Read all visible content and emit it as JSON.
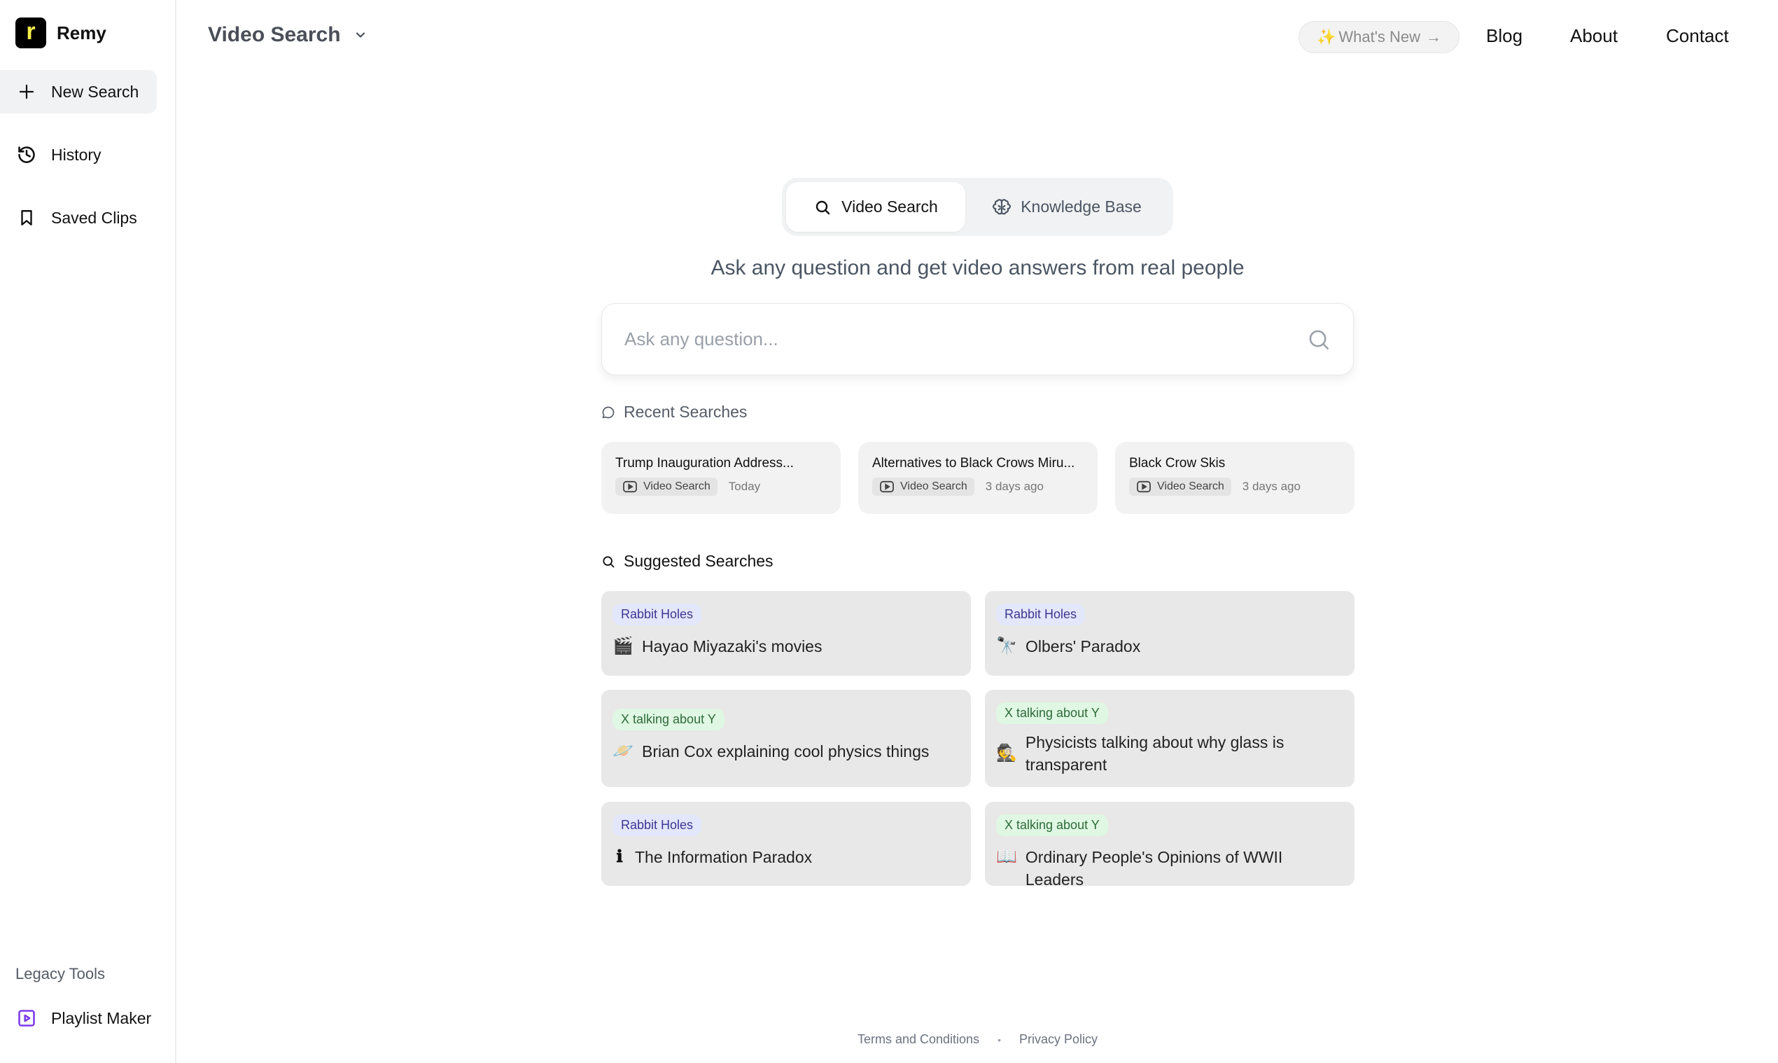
{
  "sidebar": {
    "brand": {
      "logo_letter": "r",
      "name": "Remy"
    },
    "items": [
      {
        "label": "New Search",
        "icon": "plus-icon",
        "active": true
      },
      {
        "label": "History",
        "icon": "history-icon",
        "active": false
      },
      {
        "label": "Saved Clips",
        "icon": "bookmark-icon",
        "active": false
      }
    ],
    "legacy": {
      "label": "Legacy Tools",
      "items": [
        {
          "label": "Playlist Maker",
          "icon": "play-square-icon",
          "icon_color": "#7c3aed"
        }
      ]
    }
  },
  "header": {
    "title": "Video Search",
    "whats_new": {
      "sparkle": "✨",
      "label": "What's New",
      "arrow": "→"
    },
    "links": [
      "Blog",
      "About",
      "Contact"
    ]
  },
  "mode_tabs": [
    {
      "label": "Video Search",
      "icon": "search-icon",
      "active": true
    },
    {
      "label": "Knowledge Base",
      "icon": "brain-icon",
      "active": false
    }
  ],
  "subtitle": "Ask any question and get video answers from real people",
  "search": {
    "placeholder": "Ask any question...",
    "value": ""
  },
  "recent": {
    "label": "Recent Searches",
    "items": [
      {
        "title": "Trump Inauguration Address...",
        "type": "Video Search",
        "time": "Today"
      },
      {
        "title": "Alternatives to Black Crows Miru...",
        "type": "Video Search",
        "time": "3 days ago"
      },
      {
        "title": "Black Crow Skis",
        "type": "Video Search",
        "time": "3 days ago"
      }
    ]
  },
  "suggested": {
    "label": "Suggested Searches",
    "items": [
      {
        "tag": "Rabbit Holes",
        "tag_type": "rabbit",
        "emoji": "🎬",
        "text": "Hayao Miyazaki's movies"
      },
      {
        "tag": "Rabbit Holes",
        "tag_type": "rabbit",
        "emoji": "🔭",
        "text": "Olbers' Paradox"
      },
      {
        "tag": "X talking about Y",
        "tag_type": "xy",
        "emoji": "🪐",
        "text": "Brian Cox explaining cool physics things"
      },
      {
        "tag": "X talking about Y",
        "tag_type": "xy",
        "emoji": "🕵️",
        "text": "Physicists talking about why glass is transparent"
      },
      {
        "tag": "Rabbit Holes",
        "tag_type": "rabbit",
        "emoji": "ℹ",
        "text": "The Information Paradox"
      },
      {
        "tag": "X talking about Y",
        "tag_type": "xy",
        "emoji": "📖",
        "text": "Ordinary People's Opinions of WWII Leaders"
      }
    ]
  },
  "footer": {
    "links": [
      "Terms and Conditions",
      "Privacy Policy"
    ],
    "separator": "•"
  },
  "colors": {
    "tag_rabbit_bg": "#e3e7fb",
    "tag_rabbit_fg": "#3a3892",
    "tag_xy_bg": "#dff7e3",
    "tag_xy_fg": "#2f6b3a",
    "logo_letter": "#f5ee4a"
  }
}
